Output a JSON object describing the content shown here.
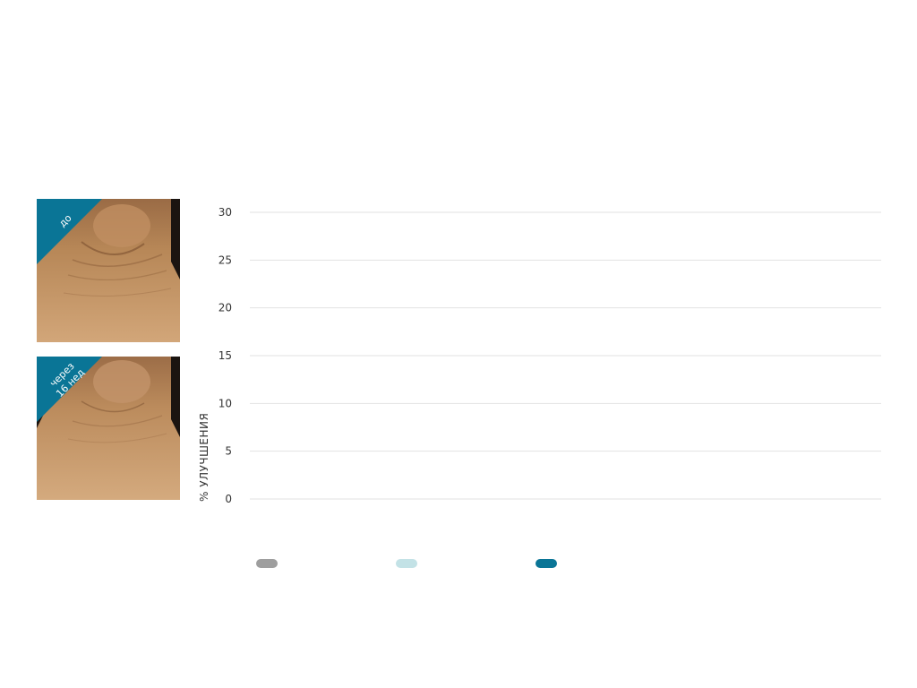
{
  "photos": [
    {
      "label": "до"
    },
    {
      "label": "через\n16 нед"
    }
  ],
  "colors": {
    "badge": "#0a7596",
    "grid": "#e2e2e2",
    "tick_text": "#333333",
    "skin_light": "#c99a6e",
    "skin_mid": "#a9784f",
    "skin_dark": "#7a4f2f"
  },
  "chart_data": {
    "type": "bar",
    "title": "",
    "xlabel": "",
    "ylabel": "% УЛУЧШЕНИЯ",
    "ylim": [
      0,
      30
    ],
    "yticks": [
      0,
      5,
      10,
      15,
      20,
      25,
      30
    ],
    "grid": true,
    "categories": [],
    "series": [
      {
        "color": "#9e9e9e",
        "values": []
      },
      {
        "color": "#c3e2e6",
        "values": []
      },
      {
        "color": "#0a7596",
        "values": []
      }
    ],
    "legend_position": "bottom-left"
  }
}
